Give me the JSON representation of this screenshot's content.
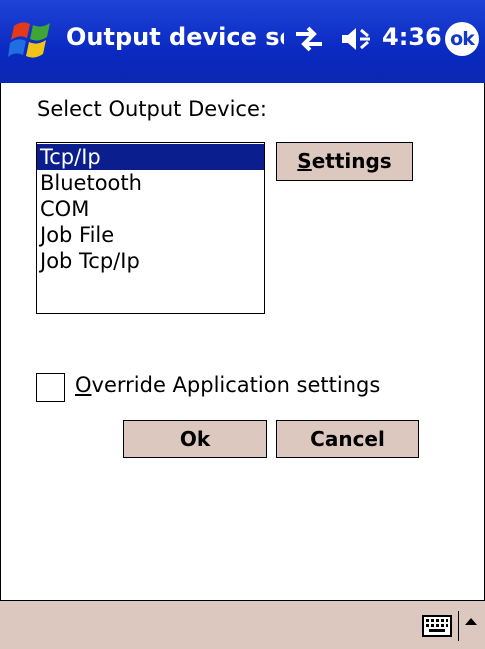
{
  "titlebar": {
    "title": "Output device selec",
    "clock": "4:36",
    "ok_label": "ok",
    "start_icon": "windows-flag-icon",
    "connectivity_icon": "connectivity-icon",
    "volume_icon": "volume-icon",
    "color": "#0a2ac2"
  },
  "main": {
    "select_label": "Select Output Device:",
    "devices": [
      "Tcp/Ip",
      "Bluetooth",
      "COM",
      "Job File",
      "Job Tcp/Ip"
    ],
    "selected_index": 0,
    "settings_button": {
      "underline": "S",
      "rest": "ettings"
    },
    "override_checkbox": {
      "underline": "O",
      "rest": "verride Application settings",
      "checked": false
    },
    "ok_button": "Ok",
    "cancel_button": "Cancel"
  },
  "bottombar": {
    "keyboard_icon": "keyboard-icon",
    "menu_arrow_icon": "arrow-up-icon",
    "color": "#dcc8bf"
  }
}
